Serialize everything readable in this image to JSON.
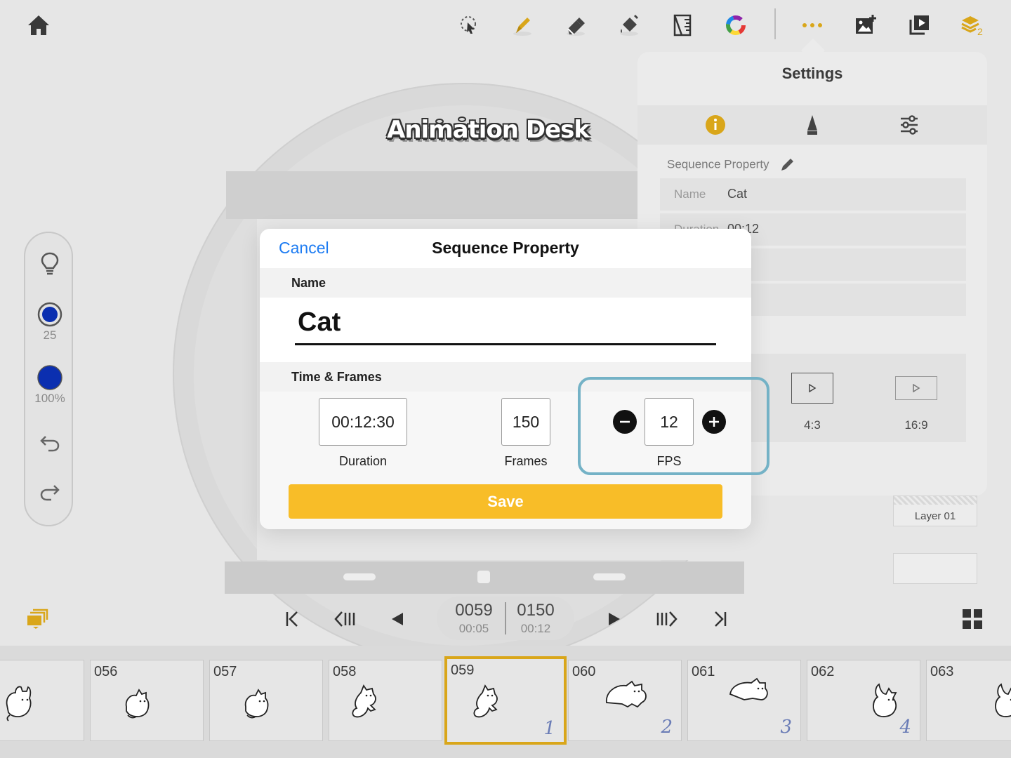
{
  "toolbar": {
    "icons": [
      "home-icon",
      "lasso-select-icon",
      "pen-brush-icon",
      "eraser-icon",
      "paint-bucket-icon",
      "ruler-icon",
      "color-wheel-icon",
      "more-icon",
      "add-image-icon",
      "playback-video-icon",
      "layers-icon"
    ],
    "layers_badge": "2",
    "accent_color": "#d9a61a"
  },
  "logo": {
    "text": "Animation Desk"
  },
  "left_panel": {
    "brush_size": "25",
    "opacity": "100%",
    "brush_color": "#0b2fb0"
  },
  "settings": {
    "title": "Settings",
    "section_label": "Sequence Property",
    "rows": [
      {
        "key": "Name",
        "value": "Cat"
      },
      {
        "key": "Duration",
        "value": "00:12"
      }
    ],
    "ratios": [
      "4:3",
      "16:9"
    ],
    "layer_label": "Layer 01"
  },
  "modal": {
    "cancel_label": "Cancel",
    "title": "Sequence Property",
    "name_section": "Name",
    "name_value": "Cat",
    "time_section": "Time & Frames",
    "duration_value": "00:12:30",
    "duration_label": "Duration",
    "frames_value": "150",
    "frames_label": "Frames",
    "fps_value": "12",
    "fps_label": "FPS",
    "save_label": "Save"
  },
  "playback": {
    "current_frame": "0059",
    "current_time": "00:05",
    "total_frames": "0150",
    "total_time": "00:12"
  },
  "filmstrip": {
    "frames": [
      {
        "num": "",
        "mark": ""
      },
      {
        "num": "056",
        "mark": ""
      },
      {
        "num": "057",
        "mark": ""
      },
      {
        "num": "058",
        "mark": ""
      },
      {
        "num": "059",
        "mark": "1"
      },
      {
        "num": "060",
        "mark": "2"
      },
      {
        "num": "061",
        "mark": "3"
      },
      {
        "num": "062",
        "mark": "4"
      },
      {
        "num": "063",
        "mark": ""
      }
    ]
  }
}
